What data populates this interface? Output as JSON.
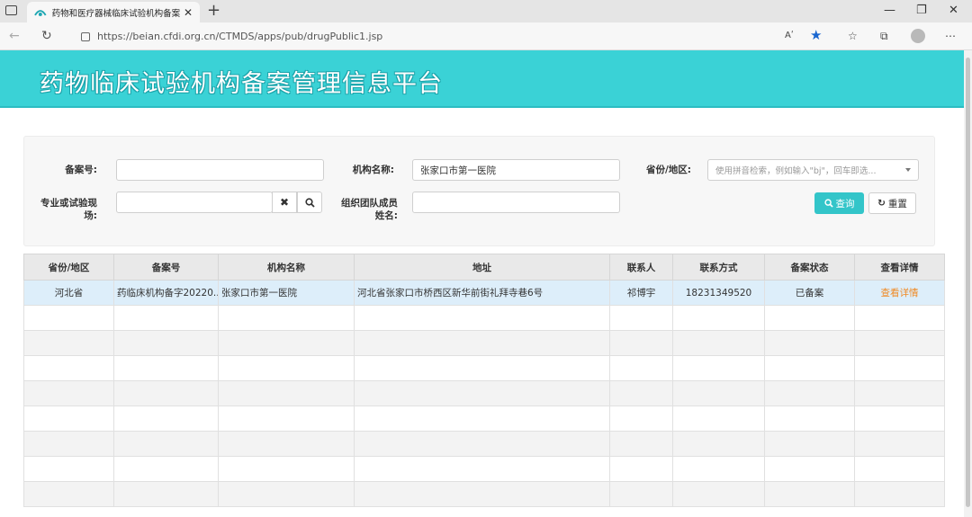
{
  "browser": {
    "tab_title": "药物和医疗器械临床试验机构备案",
    "tab_close": "✕",
    "new_tab": "+",
    "url": "https://beian.cfdi.org.cn/CTMDS/apps/pub/drugPublic1.jsp",
    "read_aloud": "Aʹ",
    "window_controls": [
      "—",
      "❐",
      "✕"
    ]
  },
  "page": {
    "title": "药物临床试验机构备案管理信息平台"
  },
  "search": {
    "record_no_label": "备案号:",
    "record_no_value": "",
    "org_name_label": "机构名称:",
    "org_name_value": "张家口市第一医院",
    "province_label": "省份/地区:",
    "province_placeholder": "使用拼音检索，例如输入\"bj\"，回车即选...",
    "specialty_label_1": "专业或试验现",
    "specialty_label_2": "场:",
    "specialty_value": "",
    "member_label_1": "组织团队成员",
    "member_label_2": "姓名:",
    "member_value": "",
    "query_button": "查询",
    "reset_button": "重置"
  },
  "table": {
    "columns": [
      "省份/地区",
      "备案号",
      "机构名称",
      "地址",
      "联系人",
      "联系方式",
      "备案状态",
      "查看详情"
    ],
    "rows": [
      {
        "province": "河北省",
        "record_no": "药临床机构备字20220...",
        "org_name": "张家口市第一医院",
        "address": "河北省张家口市桥西区新华前街礼拜寺巷6号",
        "contact": "祁博宇",
        "phone": "18231349520",
        "status": "已备案",
        "detail": "查看详情"
      }
    ]
  },
  "colors": {
    "header_bg": "#3ad2d6",
    "query_button_bg": "#33c5c9",
    "detail_link": "#f08a24",
    "selected_row": "#ddeefa",
    "star": "#1a66d0"
  }
}
